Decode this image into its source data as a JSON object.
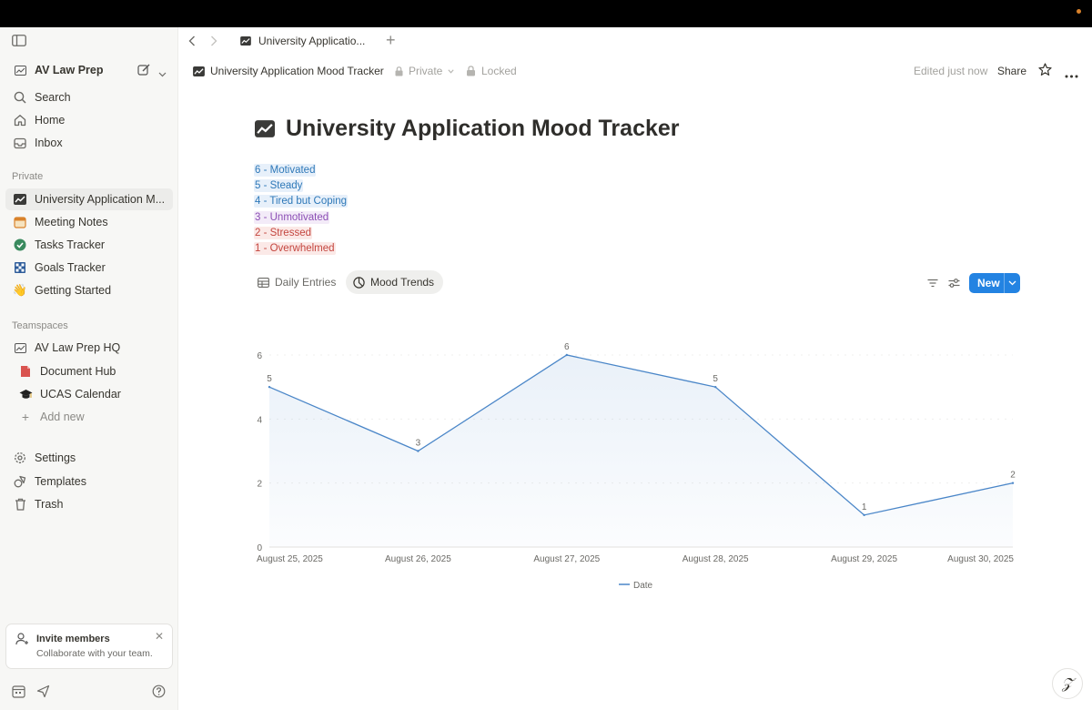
{
  "workspace": {
    "name": "AV Law Prep"
  },
  "sidebar": {
    "top_items": [
      {
        "label": "Search",
        "icon": "search-icon"
      },
      {
        "label": "Home",
        "icon": "home-icon"
      },
      {
        "label": "Inbox",
        "icon": "inbox-icon"
      }
    ],
    "private_label": "Private",
    "private_items": [
      {
        "label": "University Application M...",
        "icon": "trend-icon"
      },
      {
        "label": "Meeting Notes",
        "icon": "calendar-icon"
      },
      {
        "label": "Tasks Tracker",
        "icon": "check-circle-icon"
      },
      {
        "label": "Goals Tracker",
        "icon": "flag-icon"
      },
      {
        "label": "Getting Started",
        "icon": "wave-hand-icon"
      }
    ],
    "teamspaces_label": "Teamspaces",
    "teamspace_items": [
      {
        "label": "AV Law Prep HQ",
        "icon": "workspace-icon"
      },
      {
        "label": "Document Hub",
        "icon": "document-icon"
      },
      {
        "label": "UCAS Calendar",
        "icon": "graduation-cap-icon"
      },
      {
        "label": "Add new",
        "icon": "plus-icon"
      }
    ],
    "bottom_items": [
      {
        "label": "Settings",
        "icon": "gear-icon"
      },
      {
        "label": "Templates",
        "icon": "templates-icon"
      },
      {
        "label": "Trash",
        "icon": "trash-icon"
      }
    ],
    "invite": {
      "title": "Invite members",
      "subtitle": "Collaborate with your team."
    }
  },
  "tab": {
    "title": "University Applicatio..."
  },
  "header": {
    "breadcrumb": "University Application Mood Tracker",
    "privacy": "Private",
    "locked": "Locked",
    "edited": "Edited just now",
    "share": "Share"
  },
  "page": {
    "title": "University Application Mood Tracker",
    "legend": [
      {
        "text": "6 - Motivated",
        "color": "#2e78b8",
        "bg": "#e7f0fa"
      },
      {
        "text": "5 - Steady",
        "color": "#2e78b8",
        "bg": "#e7f0fa"
      },
      {
        "text": "4 - Tired but Coping",
        "color": "#2e78b8",
        "bg": "#e7f0fa"
      },
      {
        "text": "3 - Unmotivated",
        "color": "#8c4fb5",
        "bg": "#f3ebf8"
      },
      {
        "text": "2 - Stressed",
        "color": "#c4463f",
        "bg": "#fbe9e7"
      },
      {
        "text": "1 - Overwhelmed",
        "color": "#c4463f",
        "bg": "#fbe9e7"
      }
    ]
  },
  "views": {
    "daily_entries": "Daily Entries",
    "mood_trends": "Mood Trends",
    "new_label": "New"
  },
  "chart_data": {
    "type": "line",
    "categories": [
      "August 25, 2025",
      "August 26, 2025",
      "August 27, 2025",
      "August 28, 2025",
      "August 29, 2025",
      "August 30, 2025"
    ],
    "series": [
      {
        "name": "Date",
        "values": [
          5,
          3,
          6,
          5,
          1,
          2
        ]
      }
    ],
    "ylim": [
      0,
      6
    ],
    "yticks": [
      0,
      2,
      4,
      6
    ],
    "grid": true,
    "legend": "bottom-center",
    "line_color": "#4a86c8",
    "data_labels": true
  }
}
